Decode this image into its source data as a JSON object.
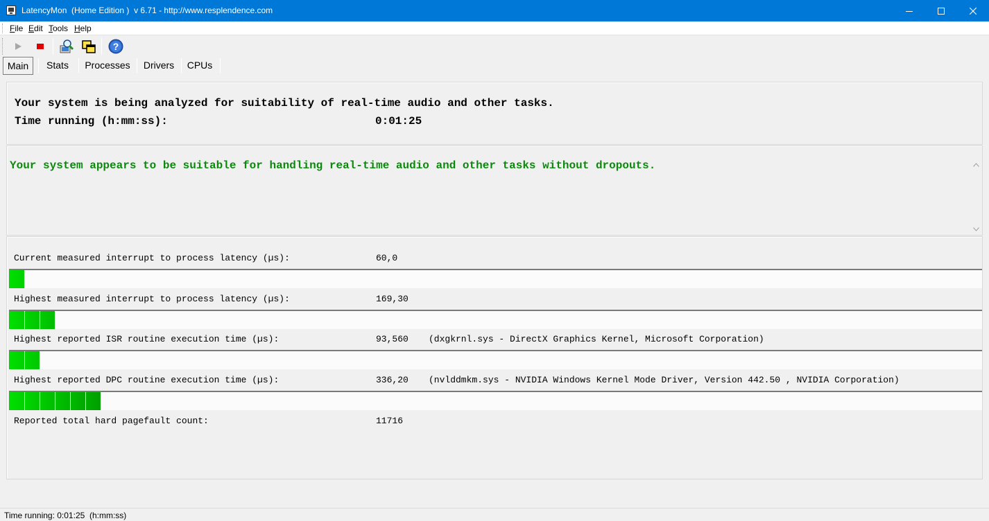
{
  "window": {
    "title": "LatencyMon  (Home Edition )  v 6.71 - http://www.resplendence.com",
    "minimize_icon": "minimize-icon",
    "maximize_icon": "maximize-icon",
    "close_icon": "close-icon"
  },
  "menu": {
    "items": [
      "File",
      "Edit",
      "Tools",
      "Help"
    ]
  },
  "toolbar": {
    "buttons": [
      "play-icon",
      "stop-icon",
      "analyze-icon",
      "windows-icon",
      "help-icon"
    ]
  },
  "tabs": [
    {
      "label": "Main",
      "active": true
    },
    {
      "label": "Stats",
      "active": false
    },
    {
      "label": "Processes",
      "active": false
    },
    {
      "label": "Drivers",
      "active": false
    },
    {
      "label": "CPUs",
      "active": false
    }
  ],
  "header": {
    "analyzing_text": "Your system is being analyzed for suitability of real-time audio and other tasks.",
    "time_label": "Time running (h:mm:ss):",
    "time_value": "0:01:25"
  },
  "verdict": {
    "text": "Your system appears to be suitable for handling real-time audio and other tasks without dropouts.",
    "color": "#0a8a0a"
  },
  "metrics": [
    {
      "label": "Current measured interrupt to process latency (µs):",
      "value": "60,0",
      "note": "",
      "bar_segments": 1
    },
    {
      "label": "Highest measured interrupt to process latency (µs):",
      "value": "169,30",
      "note": "",
      "bar_segments": 3
    },
    {
      "label": "Highest reported ISR routine execution time (µs):",
      "value": "93,560",
      "note": "(dxgkrnl.sys - DirectX Graphics Kernel, Microsoft Corporation)",
      "bar_segments": 2
    },
    {
      "label": "Highest reported DPC routine execution time (µs):",
      "value": "336,20",
      "note": "(nvlddmkm.sys - NVIDIA Windows Kernel Mode Driver, Version 442.50 , NVIDIA Corporation)",
      "bar_segments": 6
    },
    {
      "label": "Reported total hard pagefault count:",
      "value": "11716",
      "note": ""
    }
  ],
  "status": {
    "text": "Time running: 0:01:25  (h:mm:ss)"
  }
}
